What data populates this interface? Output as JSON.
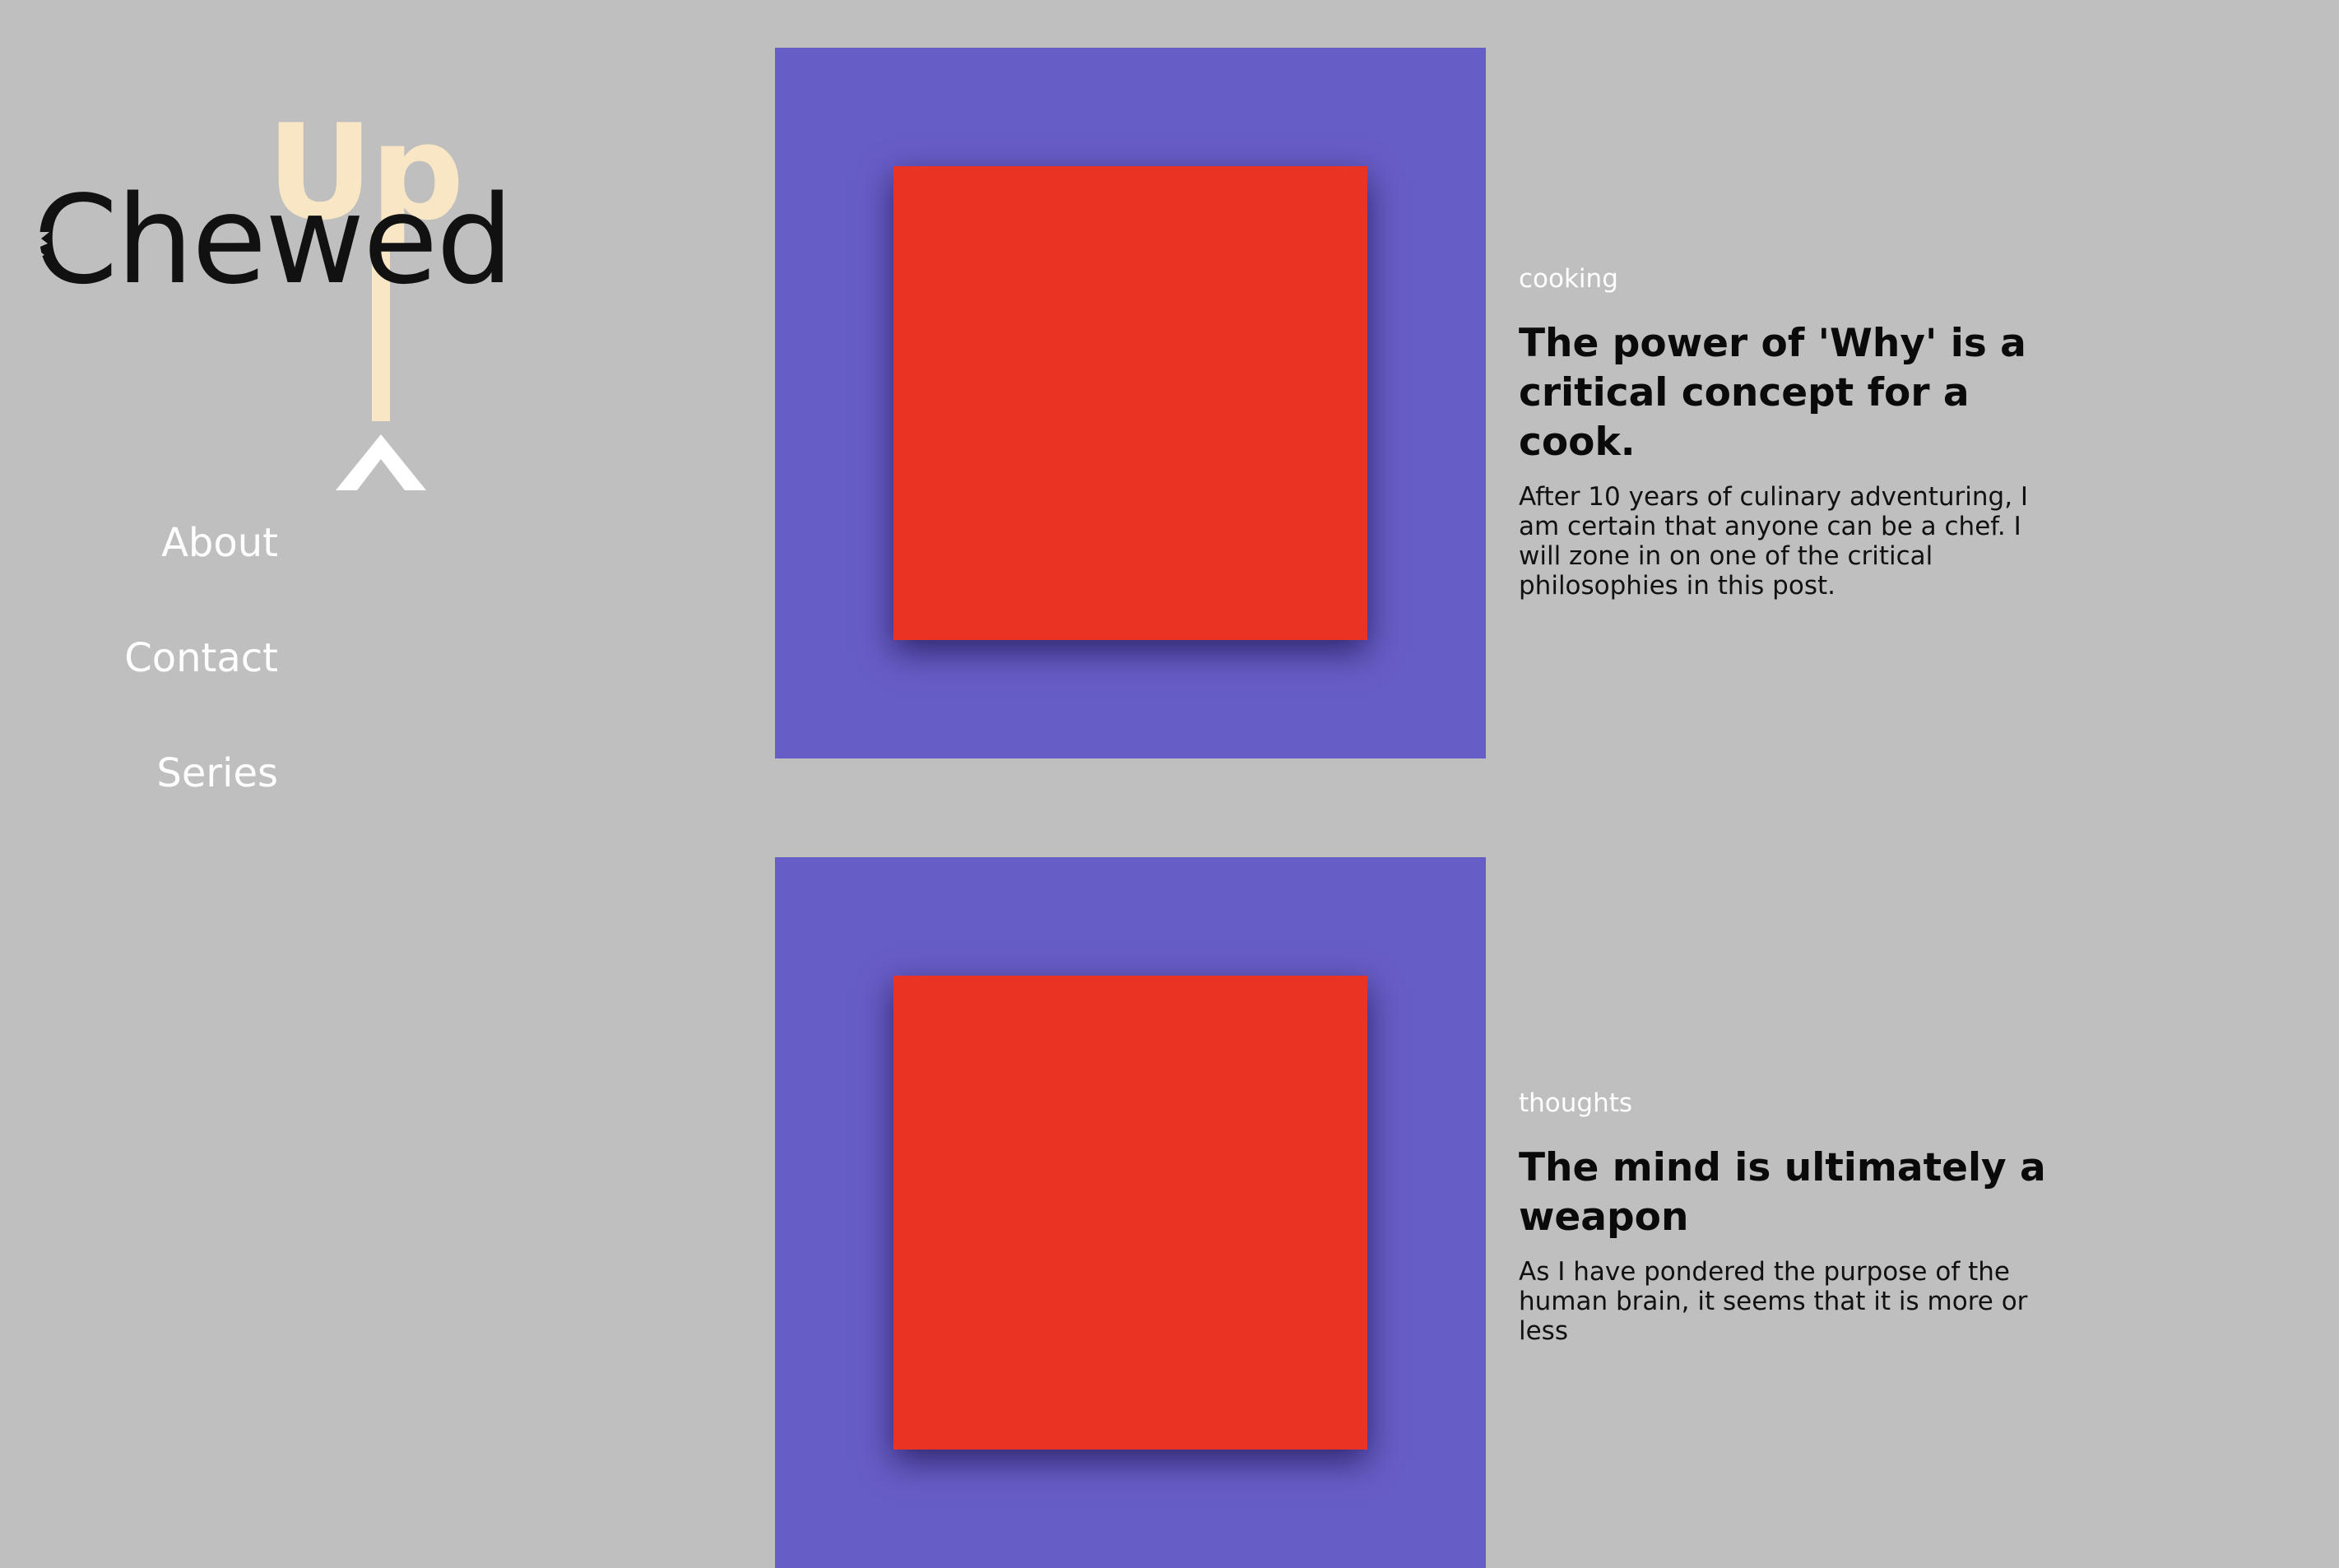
{
  "logo": {
    "word_up": "Up",
    "word_chewed": "Chewed",
    "up_color": "#f9e6c4",
    "chewed_color": "#111111",
    "up_arrow_icon": "caret-up-icon"
  },
  "nav": {
    "items": [
      {
        "label": "About"
      },
      {
        "label": "Contact"
      },
      {
        "label": "Series"
      }
    ]
  },
  "colors": {
    "background": "#bfbfbf",
    "thumb_frame": "#675dc6",
    "thumb_square": "#ea3323"
  },
  "posts": [
    {
      "category": "cooking",
      "title": "The power of 'Why' is a critical concept for a cook.",
      "excerpt": "After 10 years of culinary adventuring, I am certain that anyone can be a chef. I will zone in on one of the critical philosophies in this post."
    },
    {
      "category": "thoughts",
      "title": "The mind is ultimately a weapon",
      "excerpt": "As I have pondered the purpose of the human brain, it seems that it is more or less"
    }
  ]
}
